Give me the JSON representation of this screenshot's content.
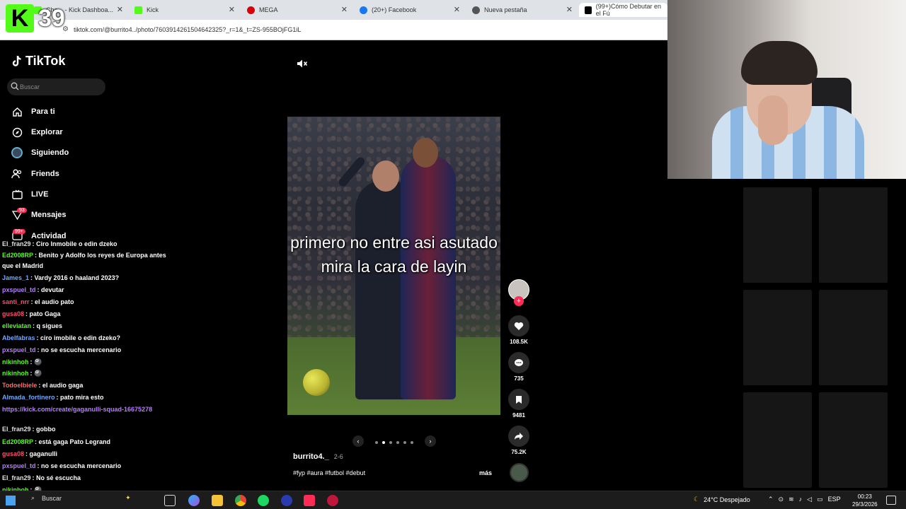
{
  "browser": {
    "tabs": [
      {
        "label": "Cha... - Kick Dashboa...",
        "color": "#53fc18"
      },
      {
        "label": "Kick",
        "color": "#53fc18"
      },
      {
        "label": "MEGA",
        "color": "#d90007"
      },
      {
        "label": "(20+) Facebook",
        "color": "#1877f2"
      },
      {
        "label": "Nueva pestaña",
        "color": "#555555"
      },
      {
        "label": "(99+)Cómo Debutar en el Fú",
        "color": "#000000"
      }
    ],
    "url": "tiktok.com/@burrito4../photo/7603914261504642325?_r=1&_t=ZS-955BOjFG1iL"
  },
  "kick_overlay": {
    "logo_letter": "K",
    "viewer_count": "39"
  },
  "tiktok": {
    "logo_text": "TikTok",
    "search_placeholder": "Buscar",
    "nav": [
      {
        "label": "Para ti",
        "icon": "home-icon"
      },
      {
        "label": "Explorar",
        "icon": "compass-icon"
      },
      {
        "label": "Siguiendo",
        "icon": "following-icon"
      },
      {
        "label": "Friends",
        "icon": "friends-icon"
      },
      {
        "label": "LIVE",
        "icon": "live-icon"
      },
      {
        "label": "Mensajes",
        "icon": "message-icon",
        "badge": "93"
      },
      {
        "label": "Actividad",
        "icon": "activity-icon",
        "badge": "99+"
      }
    ],
    "post": {
      "caption_overlay": "primero no entre asi asutado mira la cara de layin",
      "author": "burrito4._",
      "date": "2-6",
      "hashtags": "#fyp #aura #futbol #debut",
      "more_label": "más",
      "likes": "108.5K",
      "comments": "735",
      "saves": "9481",
      "shares": "75.2K"
    }
  },
  "chat": [
    {
      "user": "El_fran29",
      "text": ": Ciro Inmobile o edin dzeko",
      "color": "#e0e0e0"
    },
    {
      "user": "Ed2008RP",
      "text": ": Benito y Adolfo los reyes de Europa antes",
      "color": "#53fc18"
    },
    {
      "user": "",
      "text": "que el Madrid",
      "color": "#ffffff"
    },
    {
      "user": "James_1",
      "text": ": Vardy 2016 o haaland 2023?",
      "color": "#6fa8ff"
    },
    {
      "user": "pxspuel_td",
      "text": ": devutar",
      "color": "#b77dff"
    },
    {
      "user": "santi_nrr",
      "text": ": el audio pato",
      "color": "#ff4d6a"
    },
    {
      "user": "gusa08",
      "text": ": pato Gaga",
      "color": "#ff4d6a"
    },
    {
      "user": "elleviatan",
      "text": ": q sigues",
      "color": "#53fc18"
    },
    {
      "user": "Abelfabras",
      "text": ": ciro imobile o edin dzeko?",
      "color": "#6fa8ff"
    },
    {
      "user": "pxspuel_td",
      "text": ": no se escucha mercenario",
      "color": "#b77dff"
    },
    {
      "user": "nikinhoh",
      "text": ": 🎱",
      "color": "#53fc18"
    },
    {
      "user": "nikinhoh",
      "text": ": 🎱",
      "color": "#53fc18"
    },
    {
      "user": "Todoelbiele",
      "text": ": el audio gaga",
      "color": "#ff6b6b"
    },
    {
      "user": "Almada_fortinero",
      "text": ": pato mira esto",
      "color": "#6fa8ff"
    },
    {
      "user": "https://kick.com/create/gaganulli-squad-16675278",
      "text": "",
      "color": "#b77dff"
    },
    {
      "user": "El_fran29",
      "text": ": gobbo",
      "color": "#e0e0e0"
    },
    {
      "user": "Ed2008RP",
      "text": ": está gaga Pato Legrand",
      "color": "#53fc18"
    },
    {
      "user": "gusa08",
      "text": ": gaganulli",
      "color": "#ff4d6a"
    },
    {
      "user": "pxspuel_td",
      "text": ": no se escucha mercenario",
      "color": "#b77dff"
    },
    {
      "user": "El_fran29",
      "text": ": No sé escucha",
      "color": "#e0e0e0"
    },
    {
      "user": "nikinhoh",
      "text": ": 🎱",
      "color": "#53fc18"
    }
  ],
  "taskbar": {
    "search_label": "Buscar",
    "weather": "24°C Despejado",
    "lang": "ESP",
    "time": "00:23",
    "date": "29/3/2026"
  }
}
